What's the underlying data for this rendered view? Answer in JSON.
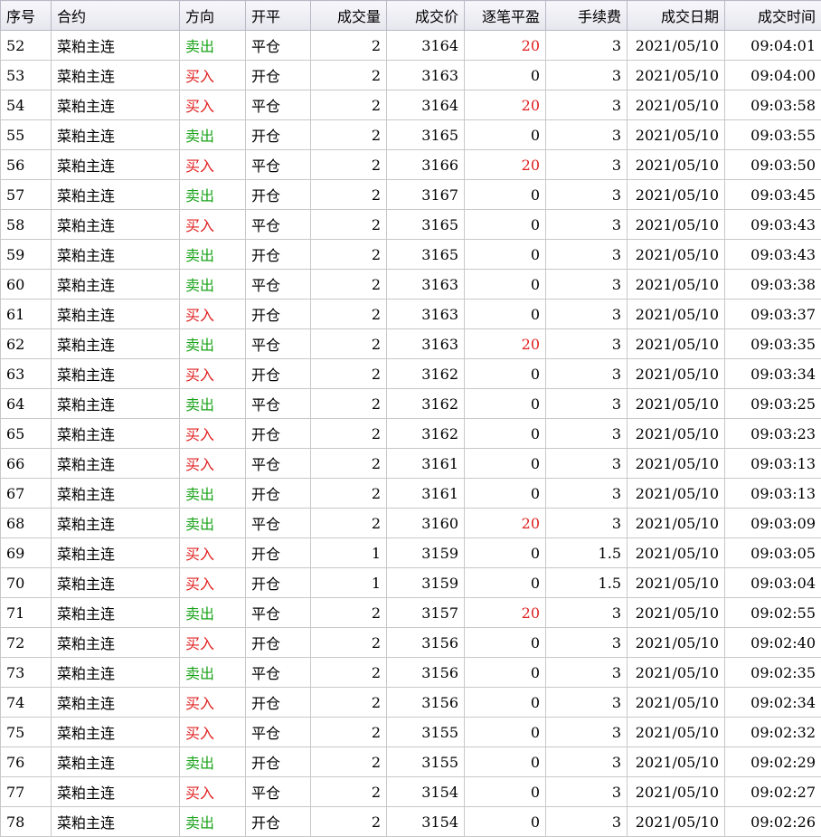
{
  "columns": [
    "序号",
    "合约",
    "方向",
    "开平",
    "成交量",
    "成交价",
    "逐笔平盈",
    "手续费",
    "成交日期",
    "成交时间"
  ],
  "colors": {
    "buy": "#e02020",
    "sell": "#1aa31a",
    "profit_positive": "#e02020"
  },
  "rows": [
    {
      "id": "52",
      "contract": "菜粕主连",
      "dir": "卖出",
      "dir_type": "sell",
      "oc": "平仓",
      "vol": "2",
      "price": "3164",
      "pnl": "20",
      "fee": "3",
      "date": "2021/05/10",
      "time": "09:04:01"
    },
    {
      "id": "53",
      "contract": "菜粕主连",
      "dir": "买入",
      "dir_type": "buy",
      "oc": "开仓",
      "vol": "2",
      "price": "3163",
      "pnl": "0",
      "fee": "3",
      "date": "2021/05/10",
      "time": "09:04:00"
    },
    {
      "id": "54",
      "contract": "菜粕主连",
      "dir": "买入",
      "dir_type": "buy",
      "oc": "平仓",
      "vol": "2",
      "price": "3164",
      "pnl": "20",
      "fee": "3",
      "date": "2021/05/10",
      "time": "09:03:58"
    },
    {
      "id": "55",
      "contract": "菜粕主连",
      "dir": "卖出",
      "dir_type": "sell",
      "oc": "开仓",
      "vol": "2",
      "price": "3165",
      "pnl": "0",
      "fee": "3",
      "date": "2021/05/10",
      "time": "09:03:55"
    },
    {
      "id": "56",
      "contract": "菜粕主连",
      "dir": "买入",
      "dir_type": "buy",
      "oc": "平仓",
      "vol": "2",
      "price": "3166",
      "pnl": "20",
      "fee": "3",
      "date": "2021/05/10",
      "time": "09:03:50"
    },
    {
      "id": "57",
      "contract": "菜粕主连",
      "dir": "卖出",
      "dir_type": "sell",
      "oc": "开仓",
      "vol": "2",
      "price": "3167",
      "pnl": "0",
      "fee": "3",
      "date": "2021/05/10",
      "time": "09:03:45"
    },
    {
      "id": "58",
      "contract": "菜粕主连",
      "dir": "买入",
      "dir_type": "buy",
      "oc": "平仓",
      "vol": "2",
      "price": "3165",
      "pnl": "0",
      "fee": "3",
      "date": "2021/05/10",
      "time": "09:03:43"
    },
    {
      "id": "59",
      "contract": "菜粕主连",
      "dir": "卖出",
      "dir_type": "sell",
      "oc": "开仓",
      "vol": "2",
      "price": "3165",
      "pnl": "0",
      "fee": "3",
      "date": "2021/05/10",
      "time": "09:03:43"
    },
    {
      "id": "60",
      "contract": "菜粕主连",
      "dir": "卖出",
      "dir_type": "sell",
      "oc": "平仓",
      "vol": "2",
      "price": "3163",
      "pnl": "0",
      "fee": "3",
      "date": "2021/05/10",
      "time": "09:03:38"
    },
    {
      "id": "61",
      "contract": "菜粕主连",
      "dir": "买入",
      "dir_type": "buy",
      "oc": "开仓",
      "vol": "2",
      "price": "3163",
      "pnl": "0",
      "fee": "3",
      "date": "2021/05/10",
      "time": "09:03:37"
    },
    {
      "id": "62",
      "contract": "菜粕主连",
      "dir": "卖出",
      "dir_type": "sell",
      "oc": "平仓",
      "vol": "2",
      "price": "3163",
      "pnl": "20",
      "fee": "3",
      "date": "2021/05/10",
      "time": "09:03:35"
    },
    {
      "id": "63",
      "contract": "菜粕主连",
      "dir": "买入",
      "dir_type": "buy",
      "oc": "开仓",
      "vol": "2",
      "price": "3162",
      "pnl": "0",
      "fee": "3",
      "date": "2021/05/10",
      "time": "09:03:34"
    },
    {
      "id": "64",
      "contract": "菜粕主连",
      "dir": "卖出",
      "dir_type": "sell",
      "oc": "平仓",
      "vol": "2",
      "price": "3162",
      "pnl": "0",
      "fee": "3",
      "date": "2021/05/10",
      "time": "09:03:25"
    },
    {
      "id": "65",
      "contract": "菜粕主连",
      "dir": "买入",
      "dir_type": "buy",
      "oc": "开仓",
      "vol": "2",
      "price": "3162",
      "pnl": "0",
      "fee": "3",
      "date": "2021/05/10",
      "time": "09:03:23"
    },
    {
      "id": "66",
      "contract": "菜粕主连",
      "dir": "买入",
      "dir_type": "buy",
      "oc": "平仓",
      "vol": "2",
      "price": "3161",
      "pnl": "0",
      "fee": "3",
      "date": "2021/05/10",
      "time": "09:03:13"
    },
    {
      "id": "67",
      "contract": "菜粕主连",
      "dir": "卖出",
      "dir_type": "sell",
      "oc": "开仓",
      "vol": "2",
      "price": "3161",
      "pnl": "0",
      "fee": "3",
      "date": "2021/05/10",
      "time": "09:03:13"
    },
    {
      "id": "68",
      "contract": "菜粕主连",
      "dir": "卖出",
      "dir_type": "sell",
      "oc": "平仓",
      "vol": "2",
      "price": "3160",
      "pnl": "20",
      "fee": "3",
      "date": "2021/05/10",
      "time": "09:03:09"
    },
    {
      "id": "69",
      "contract": "菜粕主连",
      "dir": "买入",
      "dir_type": "buy",
      "oc": "开仓",
      "vol": "1",
      "price": "3159",
      "pnl": "0",
      "fee": "1.5",
      "date": "2021/05/10",
      "time": "09:03:05"
    },
    {
      "id": "70",
      "contract": "菜粕主连",
      "dir": "买入",
      "dir_type": "buy",
      "oc": "开仓",
      "vol": "1",
      "price": "3159",
      "pnl": "0",
      "fee": "1.5",
      "date": "2021/05/10",
      "time": "09:03:04"
    },
    {
      "id": "71",
      "contract": "菜粕主连",
      "dir": "卖出",
      "dir_type": "sell",
      "oc": "平仓",
      "vol": "2",
      "price": "3157",
      "pnl": "20",
      "fee": "3",
      "date": "2021/05/10",
      "time": "09:02:55"
    },
    {
      "id": "72",
      "contract": "菜粕主连",
      "dir": "买入",
      "dir_type": "buy",
      "oc": "开仓",
      "vol": "2",
      "price": "3156",
      "pnl": "0",
      "fee": "3",
      "date": "2021/05/10",
      "time": "09:02:40"
    },
    {
      "id": "73",
      "contract": "菜粕主连",
      "dir": "卖出",
      "dir_type": "sell",
      "oc": "平仓",
      "vol": "2",
      "price": "3156",
      "pnl": "0",
      "fee": "3",
      "date": "2021/05/10",
      "time": "09:02:35"
    },
    {
      "id": "74",
      "contract": "菜粕主连",
      "dir": "买入",
      "dir_type": "buy",
      "oc": "开仓",
      "vol": "2",
      "price": "3156",
      "pnl": "0",
      "fee": "3",
      "date": "2021/05/10",
      "time": "09:02:34"
    },
    {
      "id": "75",
      "contract": "菜粕主连",
      "dir": "买入",
      "dir_type": "buy",
      "oc": "平仓",
      "vol": "2",
      "price": "3155",
      "pnl": "0",
      "fee": "3",
      "date": "2021/05/10",
      "time": "09:02:32"
    },
    {
      "id": "76",
      "contract": "菜粕主连",
      "dir": "卖出",
      "dir_type": "sell",
      "oc": "开仓",
      "vol": "2",
      "price": "3155",
      "pnl": "0",
      "fee": "3",
      "date": "2021/05/10",
      "time": "09:02:29"
    },
    {
      "id": "77",
      "contract": "菜粕主连",
      "dir": "买入",
      "dir_type": "buy",
      "oc": "平仓",
      "vol": "2",
      "price": "3154",
      "pnl": "0",
      "fee": "3",
      "date": "2021/05/10",
      "time": "09:02:27"
    },
    {
      "id": "78",
      "contract": "菜粕主连",
      "dir": "卖出",
      "dir_type": "sell",
      "oc": "开仓",
      "vol": "2",
      "price": "3154",
      "pnl": "0",
      "fee": "3",
      "date": "2021/05/10",
      "time": "09:02:26"
    }
  ]
}
